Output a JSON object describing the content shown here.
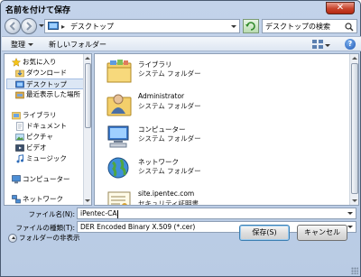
{
  "window": {
    "title": "名前を付けて保存",
    "close_label": "✕"
  },
  "address": {
    "location": "デスクトップ",
    "separator": "▸"
  },
  "search": {
    "placeholder": "デスクトップの検索"
  },
  "toolbar": {
    "organize_label": "整理",
    "new_folder_label": "新しいフォルダー",
    "help_label": "?"
  },
  "sidebar": {
    "items": [
      {
        "label": "お気に入り",
        "icon": "star-icon"
      },
      {
        "label": "ダウンロード",
        "icon": "download-folder-icon"
      },
      {
        "label": "デスクトップ",
        "icon": "desktop-icon",
        "selected": true
      },
      {
        "label": "最近表示した場所",
        "icon": "recent-places-icon"
      },
      {
        "label": "ライブラリ",
        "icon": "library-icon"
      },
      {
        "label": "ドキュメント",
        "icon": "documents-icon"
      },
      {
        "label": "ピクチャ",
        "icon": "pictures-icon"
      },
      {
        "label": "ビデオ",
        "icon": "videos-icon"
      },
      {
        "label": "ミュージック",
        "icon": "music-icon"
      },
      {
        "label": "コンピューター",
        "icon": "computer-icon"
      },
      {
        "label": "ネットワーク",
        "icon": "network-icon"
      }
    ]
  },
  "files": [
    {
      "name": "ライブラリ",
      "type": "システム フォルダー",
      "icon": "library-folder-icon"
    },
    {
      "name": "Administrator",
      "type": "システム フォルダー",
      "icon": "user-folder-icon"
    },
    {
      "name": "コンピューター",
      "type": "システム フォルダー",
      "icon": "computer-icon"
    },
    {
      "name": "ネットワーク",
      "type": "システム フォルダー",
      "icon": "network-globe-icon"
    },
    {
      "name": "site.ipentec.com",
      "type": "セキュリティ証明書",
      "icon": "certificate-icon"
    }
  ],
  "form": {
    "filename_label": "ファイル名(N):",
    "filename_value": "iPentec-CA",
    "filetype_label": "ファイルの種類(T):",
    "filetype_value": "DER Encoded Binary X.509 (*.cer)"
  },
  "footer": {
    "hide_folders_label": "フォルダーの非表示",
    "save_label": "保存(S)",
    "cancel_label": "キャンセル"
  },
  "colors": {
    "selection_bg": "#dce7f5",
    "frame": "#c3d3ea"
  }
}
